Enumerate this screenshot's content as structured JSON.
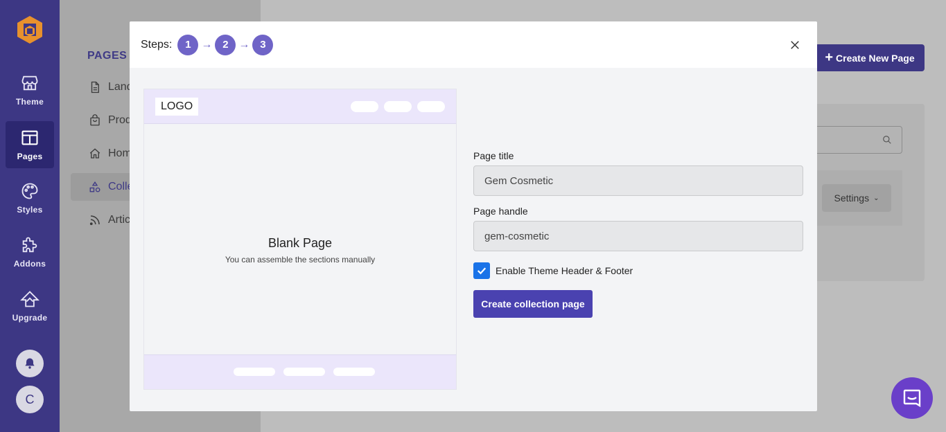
{
  "rail": {
    "items": [
      {
        "label": "Theme",
        "icon": "store-icon"
      },
      {
        "label": "Pages",
        "icon": "layout-icon"
      },
      {
        "label": "Styles",
        "icon": "palette-icon"
      },
      {
        "label": "Addons",
        "icon": "puzzle-icon"
      },
      {
        "label": "Upgrade",
        "icon": "upgrade-icon"
      }
    ],
    "avatar_letter": "C"
  },
  "sidebar": {
    "title": "PAGES",
    "items": [
      {
        "label": "Land",
        "icon": "document-icon"
      },
      {
        "label": "Prod",
        "icon": "bag-icon"
      },
      {
        "label": "Hom",
        "icon": "home-icon"
      },
      {
        "label": "Colle",
        "icon": "shapes-icon"
      },
      {
        "label": "Artic",
        "icon": "rss-icon"
      }
    ]
  },
  "background": {
    "create_button": "Create New Page",
    "settings_button": "Settings"
  },
  "modal": {
    "steps_label": "Steps:",
    "steps": [
      "1",
      "2",
      "3"
    ],
    "step_arrow": "→",
    "preview": {
      "logo": "LOGO",
      "title": "Blank Page",
      "subtitle": "You can assemble the sections manually"
    },
    "form": {
      "page_title_label": "Page title",
      "page_title_value": "Gem Cosmetic",
      "page_handle_label": "Page handle",
      "page_handle_value": "gem-cosmetic",
      "checkbox_label": "Enable Theme Header & Footer",
      "checkbox_checked": true,
      "submit_label": "Create collection page"
    }
  },
  "colors": {
    "brand": "#3d3784",
    "step": "#6f64c7",
    "submit": "#4a42b0",
    "checkbox": "#1a73e8",
    "chat": "#6a3fc9"
  }
}
